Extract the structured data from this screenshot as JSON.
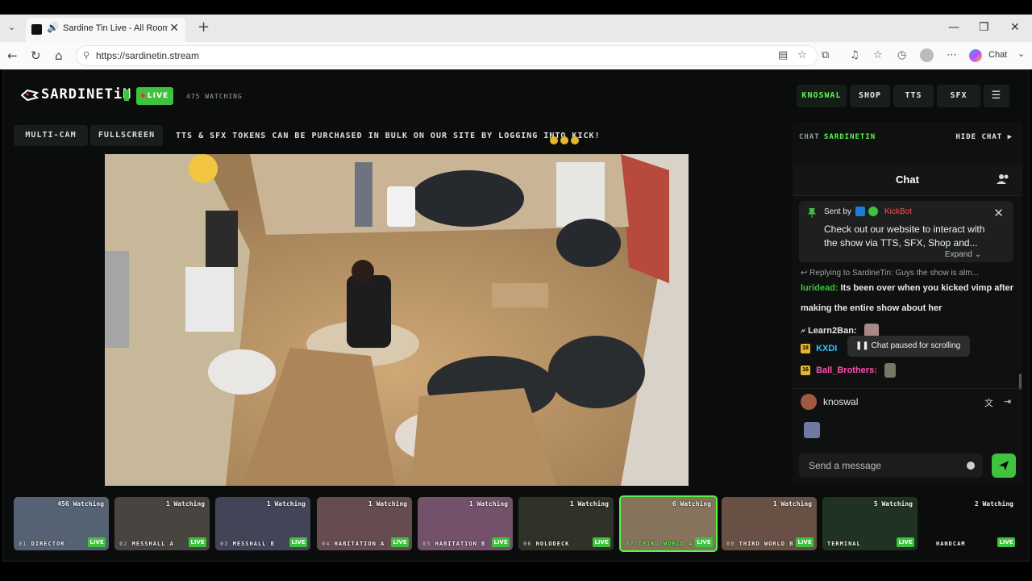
{
  "browser": {
    "tab_title": "Sardine Tin Live - All Rooms, /",
    "url": "https://sardinetin.stream",
    "profile_chat_label": "Chat"
  },
  "header": {
    "logo_text": "SARDINETiN",
    "live_label": "LIVE",
    "watching": "475 WATCHING",
    "nav": [
      "KNOSWAL",
      "SHOP",
      "TTS",
      "SFX"
    ]
  },
  "subbar": {
    "multicam": "MULTI-CAM",
    "fullscreen": "FULLSCREEN",
    "ticker": "TTS & SFX TOKENS CAN BE PURCHASED IN BULK ON OUR SITE BY LOGGING INTO KICK!"
  },
  "chat": {
    "label": "CHAT",
    "channel": "SARDINETIN",
    "hide": "HIDE CHAT ▶",
    "title": "Chat",
    "pinned": {
      "sent_by": "Sent by",
      "sender": "KickBot",
      "message": "Check out our website to interact with the show via TTS, SFX, Shop and...",
      "expand": "Expand"
    },
    "reply_line": "Replying to SardineTin: Guys the show is alm...",
    "messages": [
      {
        "user": "luridead:",
        "text": "Its been over when you kicked vimp after",
        "color": "#3fc23f"
      },
      {
        "user": "",
        "text": "making the entire show about her",
        "color": "#e8e8e8"
      },
      {
        "user": "Learn2Ban:",
        "text": "",
        "color": "#e8e8e8"
      },
      {
        "user": "KXDI",
        "text": "",
        "color": "#2ec3ff",
        "badge": "18"
      },
      {
        "user": "Ball_Brothers:",
        "text": "",
        "color": "#ff4fb0",
        "badge": "16"
      }
    ],
    "paused_tooltip": "Chat paused for scrolling",
    "current_user": "knoswal",
    "send_placeholder": "Send a message"
  },
  "cams": [
    {
      "num": "01",
      "name": "DIRECTOR",
      "watching": "456 Watching",
      "live": "LIVE",
      "color": "#5d6d83"
    },
    {
      "num": "02",
      "name": "MESSHALL A",
      "watching": "1 Watching",
      "live": "LIVE",
      "color": "#4a4743"
    },
    {
      "num": "03",
      "name": "MESSHALL B",
      "watching": "1 Watching",
      "live": "LIVE",
      "color": "#45465c"
    },
    {
      "num": "04",
      "name": "HABITATION A",
      "watching": "1 Watching",
      "live": "LIVE",
      "color": "#6b4e53"
    },
    {
      "num": "05",
      "name": "HABITATION B",
      "watching": "1 Watching",
      "live": "LIVE",
      "color": "#7a5470"
    },
    {
      "num": "06",
      "name": "HOLODECK",
      "watching": "1 Watching",
      "live": "LIVE",
      "color": "#2e3226"
    },
    {
      "num": "07",
      "name": "THIRD WORLD A",
      "watching": "6 Watching",
      "live": "LIVE",
      "color": "#8f7a60"
    },
    {
      "num": "08",
      "name": "THIRD WORLD B",
      "watching": "1 Watching",
      "live": "LIVE",
      "color": "#6f5346"
    },
    {
      "num": "",
      "name": "TERMINAL",
      "watching": "5 Watching",
      "live": "LIVE",
      "color": "#1f3120"
    },
    {
      "num": "",
      "name": "HANDCAM",
      "watching": "2 Watching",
      "live": "LIVE",
      "color": "#0b0d0c"
    }
  ]
}
